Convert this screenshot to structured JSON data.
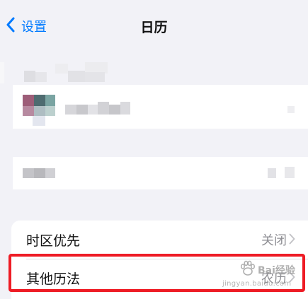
{
  "nav": {
    "back_label": "设置",
    "title": "日历"
  },
  "settings": {
    "rows": [
      {
        "label": "时区优先",
        "value": "关闭"
      },
      {
        "label": "其他历法",
        "value": "农历"
      }
    ]
  },
  "watermark": {
    "brand": "Bai经验",
    "url": "jingyan.baidu.com"
  },
  "colors": {
    "accent": "#007aff",
    "highlight": "#ee1c25"
  },
  "icons": [
    "chevron-left-icon",
    "chevron-right-icon",
    "paw-icon"
  ]
}
